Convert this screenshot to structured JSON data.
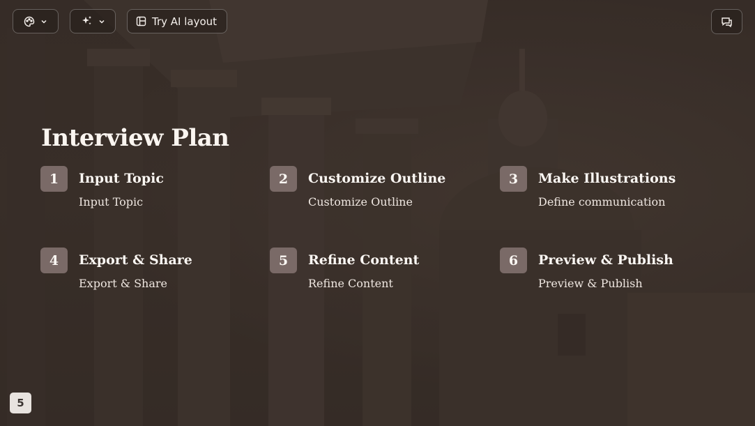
{
  "toolbar": {
    "theme_button_icon": "palette-icon",
    "ai_button_icon": "sparkle-icon",
    "layout_button_icon": "layout-icon",
    "try_ai_layout_label": "Try AI layout",
    "comment_button_icon": "comment-icon"
  },
  "slide": {
    "title": "Interview Plan",
    "page_number": "5",
    "steps": [
      {
        "number": "1",
        "title": "Input Topic",
        "description": "Input Topic"
      },
      {
        "number": "2",
        "title": "Customize Outline",
        "description": "Customize Outline"
      },
      {
        "number": "3",
        "title": "Make Illustrations",
        "description": "Define communication"
      },
      {
        "number": "4",
        "title": "Export & Share",
        "description": "Export & Share"
      },
      {
        "number": "5",
        "title": "Refine Content",
        "description": "Refine Content"
      },
      {
        "number": "6",
        "title": "Preview & Publish",
        "description": "Preview & Publish"
      }
    ]
  },
  "colors": {
    "background": "#3d322d",
    "number_badge": "#7a6a67",
    "text": "#fbf7f3"
  }
}
